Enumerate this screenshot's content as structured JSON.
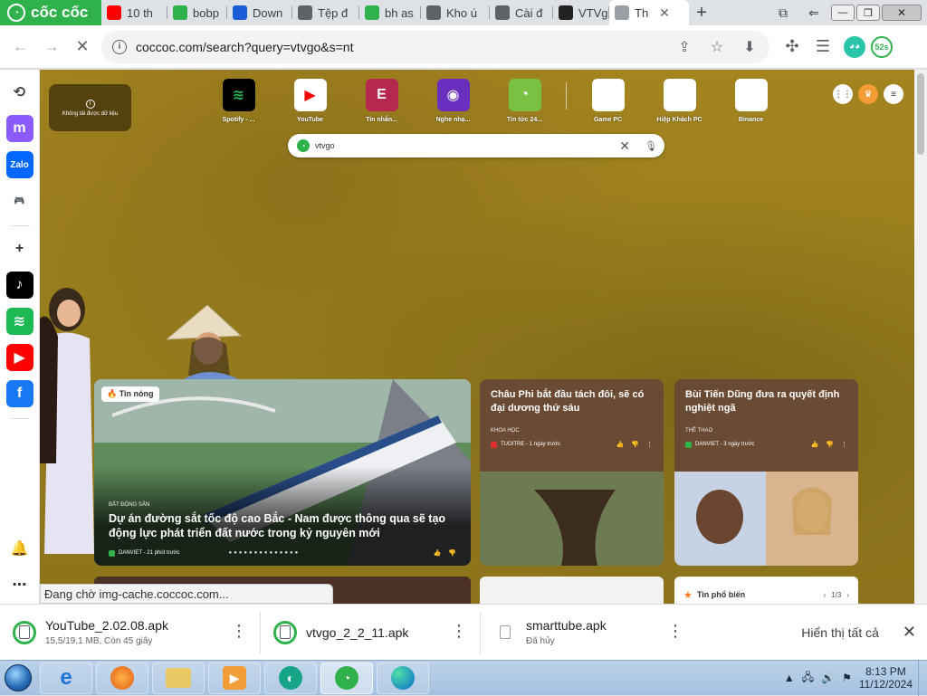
{
  "browser": {
    "brand": "cốc cốc",
    "tabs": [
      {
        "title": "10 th",
        "icon": "youtube-icon",
        "color": "#ff0000"
      },
      {
        "title": "bobp",
        "icon": "coccoc-icon",
        "color": "#2fb24c"
      },
      {
        "title": "Down",
        "icon": "download-site-icon",
        "color": "#1a5bd8"
      },
      {
        "title": "Tệp đ",
        "icon": "download-icon",
        "color": "#5f6368"
      },
      {
        "title": "bh as",
        "icon": "coccoc-icon",
        "color": "#2fb24c"
      },
      {
        "title": "Kho ú",
        "icon": "globe-icon",
        "color": "#5f6368"
      },
      {
        "title": "Cài đ",
        "icon": "settings-icon",
        "color": "#5f6368"
      },
      {
        "title": "VTVg",
        "icon": "vtvgo-icon",
        "color": "#222222"
      },
      {
        "title": "Th",
        "icon": "blank-page-icon",
        "color": "#9aa0a6",
        "active": true
      }
    ],
    "url": "coccoc.com/search?query=vtvgo&s=nt",
    "profile_badge": "52s"
  },
  "sidebar": {
    "items": [
      {
        "name": "history-icon",
        "glyph": "⟲",
        "bg": "#ffffff",
        "fg": "#444"
      },
      {
        "name": "messenger-icon",
        "glyph": "m",
        "bg": "#8a5cff",
        "fg": "#fff"
      },
      {
        "name": "zalo-icon",
        "glyph": "Zalo",
        "bg": "#0068ff",
        "fg": "#fff"
      },
      {
        "name": "game-icon",
        "glyph": "🎮",
        "bg": "#ffffff",
        "fg": "#2fb24c"
      },
      {
        "name": "add-icon",
        "glyph": "+",
        "bg": "#ffffff",
        "fg": "#333"
      },
      {
        "name": "tiktok-icon",
        "glyph": "♪",
        "bg": "#000000",
        "fg": "#fff"
      },
      {
        "name": "spotify-icon",
        "glyph": "≋",
        "bg": "#1db954",
        "fg": "#fff"
      },
      {
        "name": "youtube-icon",
        "glyph": "▶",
        "bg": "#ff0000",
        "fg": "#fff"
      },
      {
        "name": "facebook-icon",
        "glyph": "f",
        "bg": "#1877f2",
        "fg": "#fff"
      }
    ]
  },
  "newtab": {
    "weather_error": "Không tải được dữ liệu",
    "shortcuts": [
      {
        "label": "Spotify - ...",
        "bg": "#000000",
        "glyph": "≋",
        "fg": "#1db954"
      },
      {
        "label": "YouTube",
        "bg": "#ffffff",
        "glyph": "▶",
        "fg": "#ff0000"
      },
      {
        "label": "Tin nhắn...",
        "bg": "#b5284f",
        "glyph": "E",
        "fg": "#fff"
      },
      {
        "label": "Nghe nhạ...",
        "bg": "#6a2fbf",
        "glyph": "◉",
        "fg": "#fff"
      },
      {
        "label": "Tin tức 24...",
        "bg": "#7ac143",
        "glyph": "◔",
        "fg": "#fff"
      },
      {
        "label": "Game PC",
        "bg": "#ffffff",
        "glyph": "",
        "fg": "#fff"
      },
      {
        "label": "Hiệp Khách PC",
        "bg": "#ffffff",
        "glyph": "",
        "fg": "#fff"
      },
      {
        "label": "Binance",
        "bg": "#ffffff",
        "glyph": "",
        "fg": "#fff"
      }
    ],
    "search_value": "vtvgo"
  },
  "news": {
    "main": {
      "badge": "🔥 Tin nóng",
      "category": "BẤT ĐỘNG SẢN",
      "title": "Dự án đường sắt tốc độ cao Bắc - Nam được thông qua sẽ tạo động lực phát triển đất nước trong kỷ nguyên mới",
      "source": "DANVIET - 21 phút trước"
    },
    "side1": {
      "title": "Châu Phi bắt đầu tách đôi, sẽ có đại dương thứ sáu",
      "category": "KHOA HỌC",
      "source": "TUOITRE - 1 ngày trước"
    },
    "side2": {
      "title": "Bùi Tiến Dũng đưa ra quyết định nghiệt ngã",
      "category": "THỂ THAO",
      "source": "DANVIET - 3 ngày trước"
    },
    "popular": {
      "label": "Tin phổ biến",
      "pager": "1/3"
    }
  },
  "status_text": "Đang chờ img-cache.coccoc.com...",
  "downloads": {
    "items": [
      {
        "name": "YouTube_2.02.08.apk",
        "status": "15,5/19,1 MB, Còn 45 giây",
        "state": "progress"
      },
      {
        "name": "vtvgo_2_2_11.apk",
        "status": "",
        "state": "progress"
      },
      {
        "name": "smarttube.apk",
        "status": "Đã hủy",
        "state": "cancelled"
      }
    ],
    "show_all": "Hiển thị tất cả"
  },
  "taskbar": {
    "time": "8:13 PM",
    "date": "11/12/2024"
  }
}
